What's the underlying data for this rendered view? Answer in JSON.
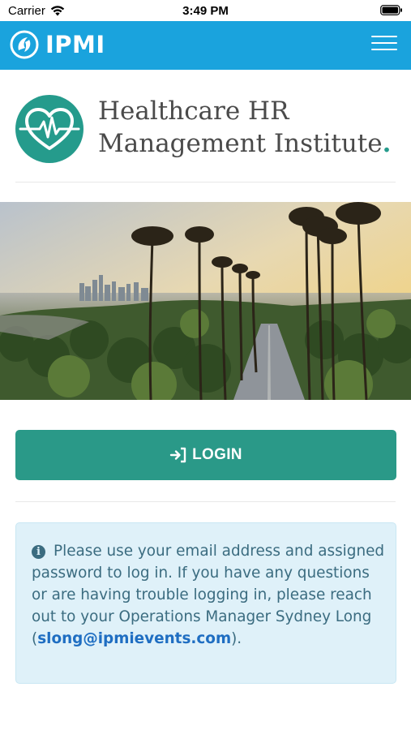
{
  "status_bar": {
    "carrier": "Carrier",
    "time": "3:49 PM"
  },
  "navbar": {
    "brand": "IPMI",
    "icons": [
      "ipmi-logo-icon",
      "hamburger-menu-icon"
    ],
    "background_color": "#1aa3dd"
  },
  "org": {
    "name_line1": "Healthcare HR",
    "name_line2": "Management Institute",
    "name_dot": ".",
    "logo_icon": "heart-heartbeat-icon",
    "accent_color": "#259b8c"
  },
  "login": {
    "label": "LOGIN",
    "icon": "sign-in-icon",
    "color": "#2a9988"
  },
  "notice": {
    "icon": "info-icon",
    "text_before": "Please use your email address and assigned password to log in. If you have any questions or are having trouble logging in, please reach out to your Operations Manager Sydney Long (",
    "email": "slong@ipmievents.com",
    "text_after": ")."
  }
}
